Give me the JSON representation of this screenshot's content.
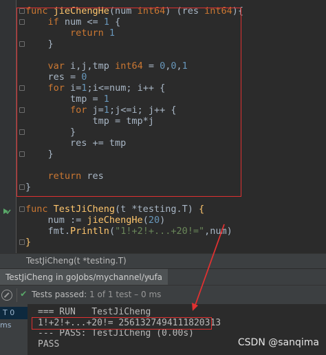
{
  "editor": {
    "lines": [
      [
        {
          "t": "func ",
          "c": "kw"
        },
        {
          "t": "jieChengHe",
          "c": "fn"
        },
        {
          "t": "(num ",
          "c": ""
        },
        {
          "t": "int64",
          "c": "ty"
        },
        {
          "t": ") (res ",
          "c": ""
        },
        {
          "t": "int64",
          "c": "ty"
        },
        {
          "t": "){",
          "c": ""
        }
      ],
      [
        {
          "t": "    if ",
          "c": "kw"
        },
        {
          "t": "num <= ",
          "c": ""
        },
        {
          "t": "1",
          "c": "num"
        },
        {
          "t": " {",
          "c": ""
        }
      ],
      [
        {
          "t": "        return ",
          "c": "kw"
        },
        {
          "t": "1",
          "c": "num"
        }
      ],
      [
        {
          "t": "    }",
          "c": ""
        }
      ],
      [],
      [
        {
          "t": "    var ",
          "c": "kw"
        },
        {
          "t": "i,j,tmp ",
          "c": ""
        },
        {
          "t": "int64",
          "c": "ty"
        },
        {
          "t": " = ",
          "c": ""
        },
        {
          "t": "0",
          "c": "num"
        },
        {
          "t": ",",
          "c": ""
        },
        {
          "t": "0",
          "c": "num"
        },
        {
          "t": ",",
          "c": ""
        },
        {
          "t": "1",
          "c": "num"
        }
      ],
      [
        {
          "t": "    res = ",
          "c": ""
        },
        {
          "t": "0",
          "c": "num"
        }
      ],
      [
        {
          "t": "    for ",
          "c": "kw"
        },
        {
          "t": "i=",
          "c": ""
        },
        {
          "t": "1",
          "c": "num"
        },
        {
          "t": ";i<=num; i++ {",
          "c": ""
        }
      ],
      [
        {
          "t": "        tmp = ",
          "c": ""
        },
        {
          "t": "1",
          "c": "num"
        }
      ],
      [
        {
          "t": "        for ",
          "c": "kw"
        },
        {
          "t": "j=",
          "c": ""
        },
        {
          "t": "1",
          "c": "num"
        },
        {
          "t": ";j<=i; j++ {",
          "c": ""
        }
      ],
      [
        {
          "t": "            tmp = tmp*j",
          "c": ""
        }
      ],
      [
        {
          "t": "        }",
          "c": ""
        }
      ],
      [
        {
          "t": "        res += tmp",
          "c": ""
        }
      ],
      [
        {
          "t": "    }",
          "c": ""
        }
      ],
      [],
      [
        {
          "t": "    return ",
          "c": "kw"
        },
        {
          "t": "res",
          "c": ""
        }
      ],
      [
        {
          "t": "}",
          "c": ""
        }
      ],
      [],
      [
        {
          "t": "func ",
          "c": "kw"
        },
        {
          "t": "TestJiCheng",
          "c": "fn"
        },
        {
          "t": "(t *testing.T) ",
          "c": ""
        },
        {
          "t": "{",
          "c": "fn"
        }
      ],
      [
        {
          "t": "    num := ",
          "c": ""
        },
        {
          "t": "jieChengHe",
          "c": "fn"
        },
        {
          "t": "(",
          "c": ""
        },
        {
          "t": "20",
          "c": "num"
        },
        {
          "t": ")",
          "c": ""
        }
      ],
      [
        {
          "t": "    fmt.",
          "c": ""
        },
        {
          "t": "Println",
          "c": "fn"
        },
        {
          "t": "(",
          "c": ""
        },
        {
          "t": "\"1!+2!+...+20!=\"",
          "c": "str"
        },
        {
          "t": ",num)",
          "c": ""
        }
      ],
      [
        {
          "t": "}",
          "c": "fn"
        }
      ]
    ]
  },
  "breadcrumb": "TestJiCheng(t *testing.T)",
  "run_tab": {
    "label": "TestJiCheng in goJobs/mychannel/yufa",
    "close": "×"
  },
  "toolbar": {
    "status": "Tests passed:",
    "count": "1 of 1 test – 0 ms"
  },
  "test_tree": {
    "item": "T 0 ms"
  },
  "console": {
    "lines": [
      "=== RUN   TestJiCheng",
      "1!+2!+...+20!= 2561327494111820313",
      "--- PASS: TestJiCheng (0.00s)",
      "PASS"
    ]
  },
  "watermark": "CSDN @sanqima",
  "colors": {
    "annotation_red": "#e03131",
    "pass_green": "#59a869"
  },
  "icons": [
    "run-test-icon",
    "stop-icon",
    "check-icon",
    "fold-marker-icon",
    "close-icon"
  ]
}
